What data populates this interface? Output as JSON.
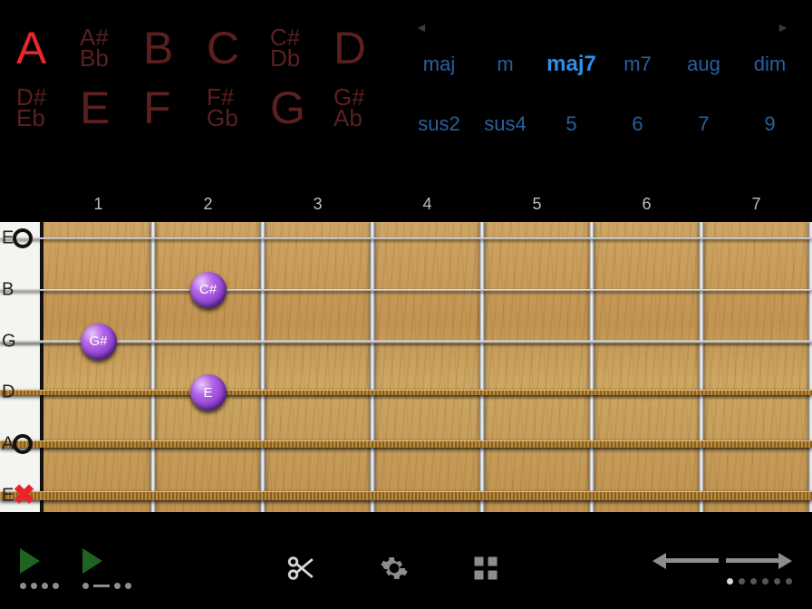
{
  "roots": [
    {
      "label": "A",
      "type": "big",
      "selected": true
    },
    {
      "sharp": "A#",
      "flat": "Bb",
      "type": "dbl"
    },
    {
      "label": "B",
      "type": "big"
    },
    {
      "label": "C",
      "type": "big"
    },
    {
      "sharp": "C#",
      "flat": "Db",
      "type": "dbl"
    },
    {
      "label": "D",
      "type": "big"
    },
    {
      "sharp": "D#",
      "flat": "Eb",
      "type": "dbl"
    },
    {
      "label": "E",
      "type": "big"
    },
    {
      "label": "F",
      "type": "big"
    },
    {
      "sharp": "F#",
      "flat": "Gb",
      "type": "dbl"
    },
    {
      "label": "G",
      "type": "big"
    },
    {
      "sharp": "G#",
      "flat": "Ab",
      "type": "dbl"
    }
  ],
  "qualities_row1": [
    {
      "label": "maj"
    },
    {
      "label": "m"
    },
    {
      "label": "maj7",
      "selected": true
    },
    {
      "label": "m7"
    },
    {
      "label": "aug"
    },
    {
      "label": "dim"
    }
  ],
  "qualities_row2": [
    {
      "label": "sus2"
    },
    {
      "label": "sus4"
    },
    {
      "label": "5"
    },
    {
      "label": "6"
    },
    {
      "label": "7"
    },
    {
      "label": "9"
    }
  ],
  "fret_numbers": [
    "1",
    "2",
    "3",
    "4",
    "5",
    "6",
    "7"
  ],
  "strings": [
    {
      "name": "E",
      "thick": 2,
      "wound": false,
      "mark": "open"
    },
    {
      "name": "B",
      "thick": 2,
      "wound": false,
      "mark": null
    },
    {
      "name": "G",
      "thick": 3,
      "wound": false,
      "mark": null
    },
    {
      "name": "D",
      "thick": 6,
      "wound": true,
      "mark": null
    },
    {
      "name": "A",
      "thick": 8,
      "wound": true,
      "mark": "open"
    },
    {
      "name": "E",
      "thick": 10,
      "wound": true,
      "mark": "x"
    }
  ],
  "dots": [
    {
      "string": 1,
      "fret": 2,
      "label": "C#"
    },
    {
      "string": 2,
      "fret": 1,
      "label": "G#"
    },
    {
      "string": 3,
      "fret": 2,
      "label": "E"
    }
  ],
  "nav_arrows": {
    "left": "◄",
    "right": "►"
  },
  "pager": {
    "count": 6,
    "active": 0
  },
  "colors": {
    "accent_red": "#e8262a",
    "root_dim": "#5c1f1f",
    "quality_dim": "#2a5f9e",
    "quality_sel": "#2f8fe8",
    "dot_fill": "#8a3bd1",
    "play_green": "#1f6320"
  }
}
